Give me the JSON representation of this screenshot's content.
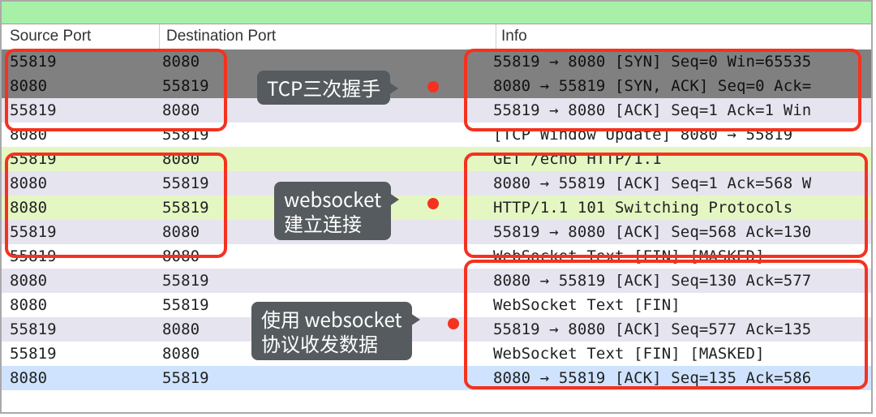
{
  "headers": {
    "source": "Source Port",
    "dest": "Destination Port",
    "info": "Info"
  },
  "rows": [
    {
      "style": "sel",
      "src": "55819",
      "dst": "8080",
      "info": "55819 → 8080 [SYN] Seq=0 Win=65535"
    },
    {
      "style": "sel",
      "src": "8080",
      "dst": "55819",
      "info": "8080 → 55819 [SYN, ACK] Seq=0 Ack="
    },
    {
      "style": "alt",
      "src": "55819",
      "dst": "8080",
      "info": "55819 → 8080 [ACK] Seq=1 Ack=1 Win"
    },
    {
      "style": "plain",
      "src": "8080",
      "dst": "55819",
      "info": "[TCP Window Update] 8080 → 55819 "
    },
    {
      "style": "hl",
      "src": "55819",
      "dst": "8080",
      "info": "GET /echo HTTP/1.1"
    },
    {
      "style": "alt",
      "src": "8080",
      "dst": "55819",
      "info": "8080 → 55819 [ACK] Seq=1 Ack=568 W"
    },
    {
      "style": "hl",
      "src": "8080",
      "dst": "55819",
      "info": "HTTP/1.1 101 Switching Protocols"
    },
    {
      "style": "alt",
      "src": "55819",
      "dst": "8080",
      "info": "55819 → 8080 [ACK] Seq=568 Ack=130"
    },
    {
      "style": "plain",
      "src": "55819",
      "dst": "8080",
      "info": "WebSocket Text [FIN] [MASKED]"
    },
    {
      "style": "alt",
      "src": "8080",
      "dst": "55819",
      "info": "8080 → 55819 [ACK] Seq=130 Ack=577"
    },
    {
      "style": "plain",
      "src": "8080",
      "dst": "55819",
      "info": "WebSocket Text [FIN]"
    },
    {
      "style": "alt",
      "src": "55819",
      "dst": "8080",
      "info": "55819 → 8080 [ACK] Seq=577 Ack=135"
    },
    {
      "style": "plain",
      "src": "55819",
      "dst": "8080",
      "info": "WebSocket Text [FIN] [MASKED]"
    },
    {
      "style": "blue",
      "src": "8080",
      "dst": "55819",
      "info": "8080 → 55819 [ACK] Seq=135 Ack=586"
    }
  ],
  "callouts": {
    "tcp": "TCP三次握手",
    "ws": "websocket\n建立连接",
    "data": "使用 websocket\n协议收发数据"
  }
}
